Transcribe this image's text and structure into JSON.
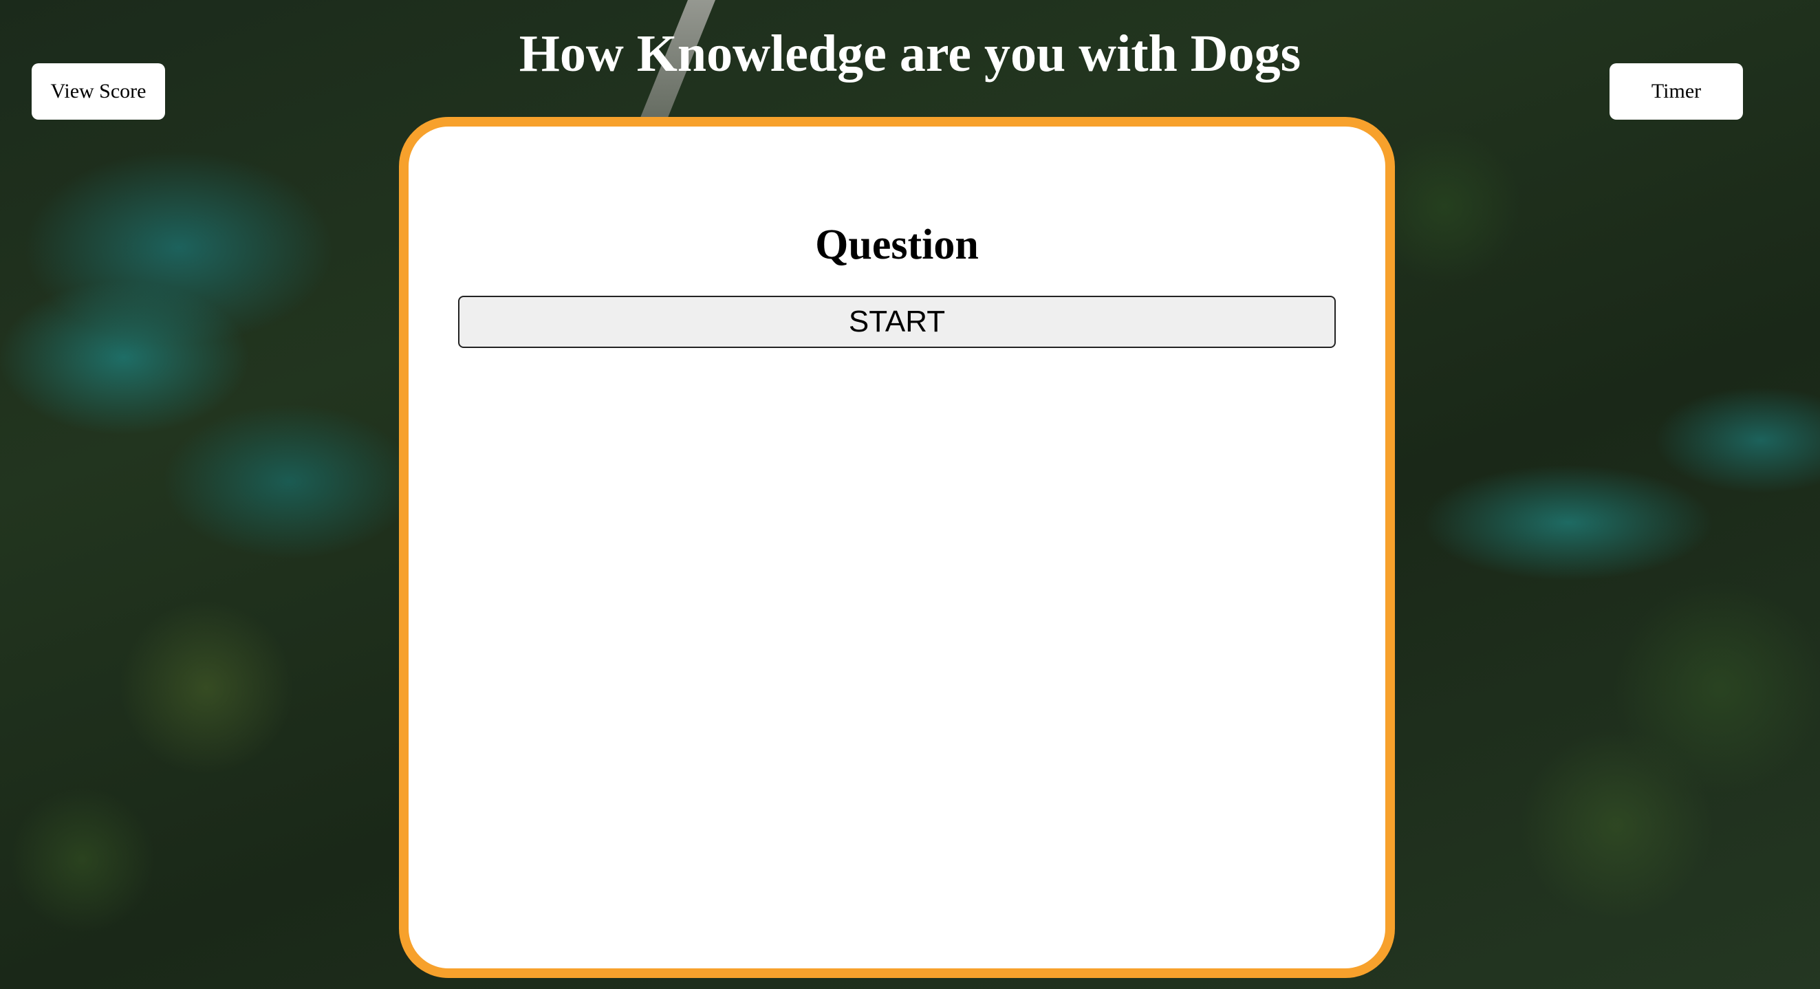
{
  "header": {
    "title": "How Knowledge are you with Dogs",
    "view_score_label": "View Score",
    "timer_label": "Timer"
  },
  "quiz": {
    "question_heading": "Question",
    "start_label": "START"
  },
  "colors": {
    "card_border": "#f7a12c",
    "card_background": "#ffffff",
    "title_text": "#ffffff",
    "start_button_background": "#efefef"
  }
}
